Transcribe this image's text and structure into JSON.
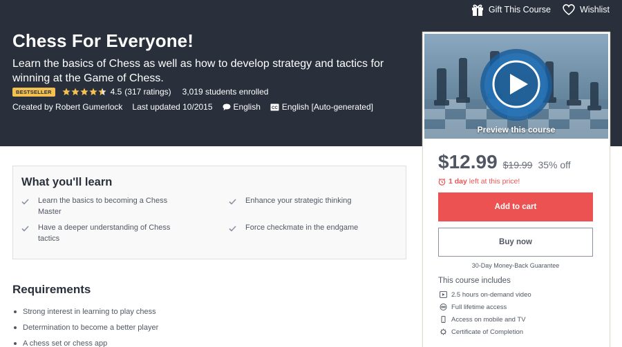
{
  "topbar": {
    "gift_label": "Gift This Course",
    "wishlist_label": "Wishlist"
  },
  "course": {
    "title": "Chess For Everyone!",
    "subtitle": "Learn the basics of Chess as well as how to develop strategy and tactics for winning at the Game of Chess.",
    "badge": "BESTSELLER",
    "rating_value": 4.5,
    "rating": "4.5",
    "rating_count": "(317 ratings)",
    "students": "3,019 students enrolled",
    "created_by": "Created by Robert Gumerlock",
    "last_updated": "Last updated 10/2015",
    "language": "English",
    "captions": "English [Auto-generated]"
  },
  "sidebar": {
    "preview_label": "Preview this course",
    "price": "$12.99",
    "original_price": "$19.99",
    "discount": "35% off",
    "timer_bold": "1 day",
    "timer_rest": " left at this price!",
    "add_to_cart": "Add to cart",
    "buy_now": "Buy now",
    "guarantee": "30-Day Money-Back Guarantee",
    "includes_title": "This course includes",
    "includes": [
      {
        "icon": "video-icon",
        "text": "2.5 hours on-demand video"
      },
      {
        "icon": "infinity-icon",
        "text": "Full lifetime access"
      },
      {
        "icon": "mobile-icon",
        "text": "Access on mobile and TV"
      },
      {
        "icon": "certificate-icon",
        "text": "Certificate of Completion"
      }
    ]
  },
  "learn": {
    "title": "What you'll learn",
    "items": [
      "Learn the basics to becoming a Chess Master",
      "Enhance your strategic thinking",
      "Have a deeper understanding of Chess tactics",
      "Force checkmate in the endgame"
    ]
  },
  "requirements": {
    "title": "Requirements",
    "items": [
      "Strong interest in learning to play chess",
      "Determination to become a better player",
      "A chess set or chess app"
    ]
  },
  "colors": {
    "hero_bg": "#29303b",
    "accent_red": "#ec5252",
    "badge_yellow": "#f4c150",
    "star": "#f4c150"
  }
}
